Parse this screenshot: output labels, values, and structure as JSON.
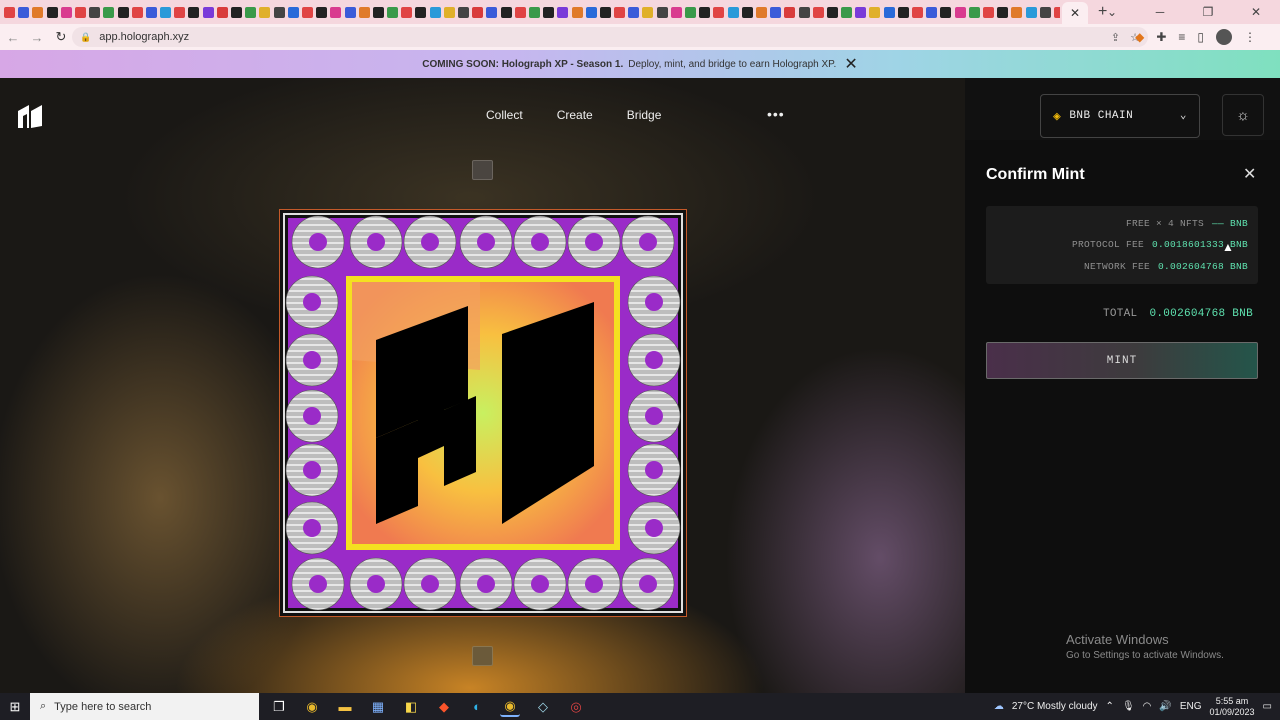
{
  "browser": {
    "url": "app.holograph.xyz",
    "active_tab_close": "✕",
    "new_tab": "+",
    "window_controls": [
      "⌄",
      "─",
      "❐",
      "✕"
    ],
    "tab_icon_colors": [
      "#e04444",
      "#3b5bd9",
      "#e07a2a",
      "#222222",
      "#d93b8f",
      "#e04444",
      "#444444",
      "#3a9a4a",
      "#222222",
      "#e04444",
      "#3b5bd9",
      "#2a9ad9",
      "#e04444",
      "#222222",
      "#7a3ad9",
      "#d93b3b",
      "#222222",
      "#3a9a4a",
      "#e0b02a",
      "#444444",
      "#2a6ad9",
      "#e04444",
      "#222222",
      "#d93b8f",
      "#3b5bd9",
      "#e07a2a",
      "#222222",
      "#3a9a4a",
      "#e04444",
      "#222222",
      "#2a9ad9",
      "#e0b02a",
      "#444444",
      "#d93b3b",
      "#3b5bd9",
      "#222222",
      "#e04444",
      "#3a9a4a",
      "#222222",
      "#7a3ad9",
      "#e07a2a",
      "#2a6ad9",
      "#222222",
      "#e04444",
      "#3b5bd9",
      "#e0b02a",
      "#444444",
      "#d93b8f",
      "#3a9a4a",
      "#222222",
      "#e04444",
      "#2a9ad9",
      "#222222",
      "#e07a2a",
      "#3b5bd9",
      "#d93b3b",
      "#444444",
      "#e04444",
      "#222222",
      "#3a9a4a",
      "#7a3ad9",
      "#e0b02a",
      "#2a6ad9",
      "#222222",
      "#e04444",
      "#3b5bd9",
      "#222222",
      "#d93b8f",
      "#3a9a4a",
      "#e04444",
      "#222222",
      "#e07a2a",
      "#2a9ad9",
      "#444444",
      "#e04444",
      "#3b5bd9",
      "#222222",
      "#e0b02a"
    ]
  },
  "banner": {
    "bold": "COMING SOON: Holograph XP - Season 1.",
    "text": "Deploy, mint, and bridge to earn Holograph XP.",
    "close": "✕"
  },
  "nav": {
    "items": [
      "Collect",
      "Create",
      "Bridge"
    ],
    "more": "•••"
  },
  "chain_selector": {
    "label": "BNB CHAIN",
    "chevron": "⌄"
  },
  "theme_toggle": {
    "icon": "☼"
  },
  "confirm_panel": {
    "title": "Confirm Mint",
    "close": "✕",
    "fees": [
      {
        "label": "FREE × 4 NFTS",
        "value": "—— BNB"
      },
      {
        "label": "PROTOCOL FEE",
        "value": "0.0018601333 BNB"
      },
      {
        "label": "NETWORK FEE",
        "value": "0.002604768 BNB"
      }
    ],
    "total_label": "TOTAL",
    "total_value": "0.002604768 BNB",
    "mint_button": "MINT"
  },
  "watermark": {
    "line1": "Activate Windows",
    "line2": "Go to Settings to activate Windows."
  },
  "taskbar": {
    "search_placeholder": "Type here to search",
    "weather": "27°C  Mostly cloudy",
    "language": "ENG",
    "time": "5:55 am",
    "date": "01/09/2023"
  }
}
